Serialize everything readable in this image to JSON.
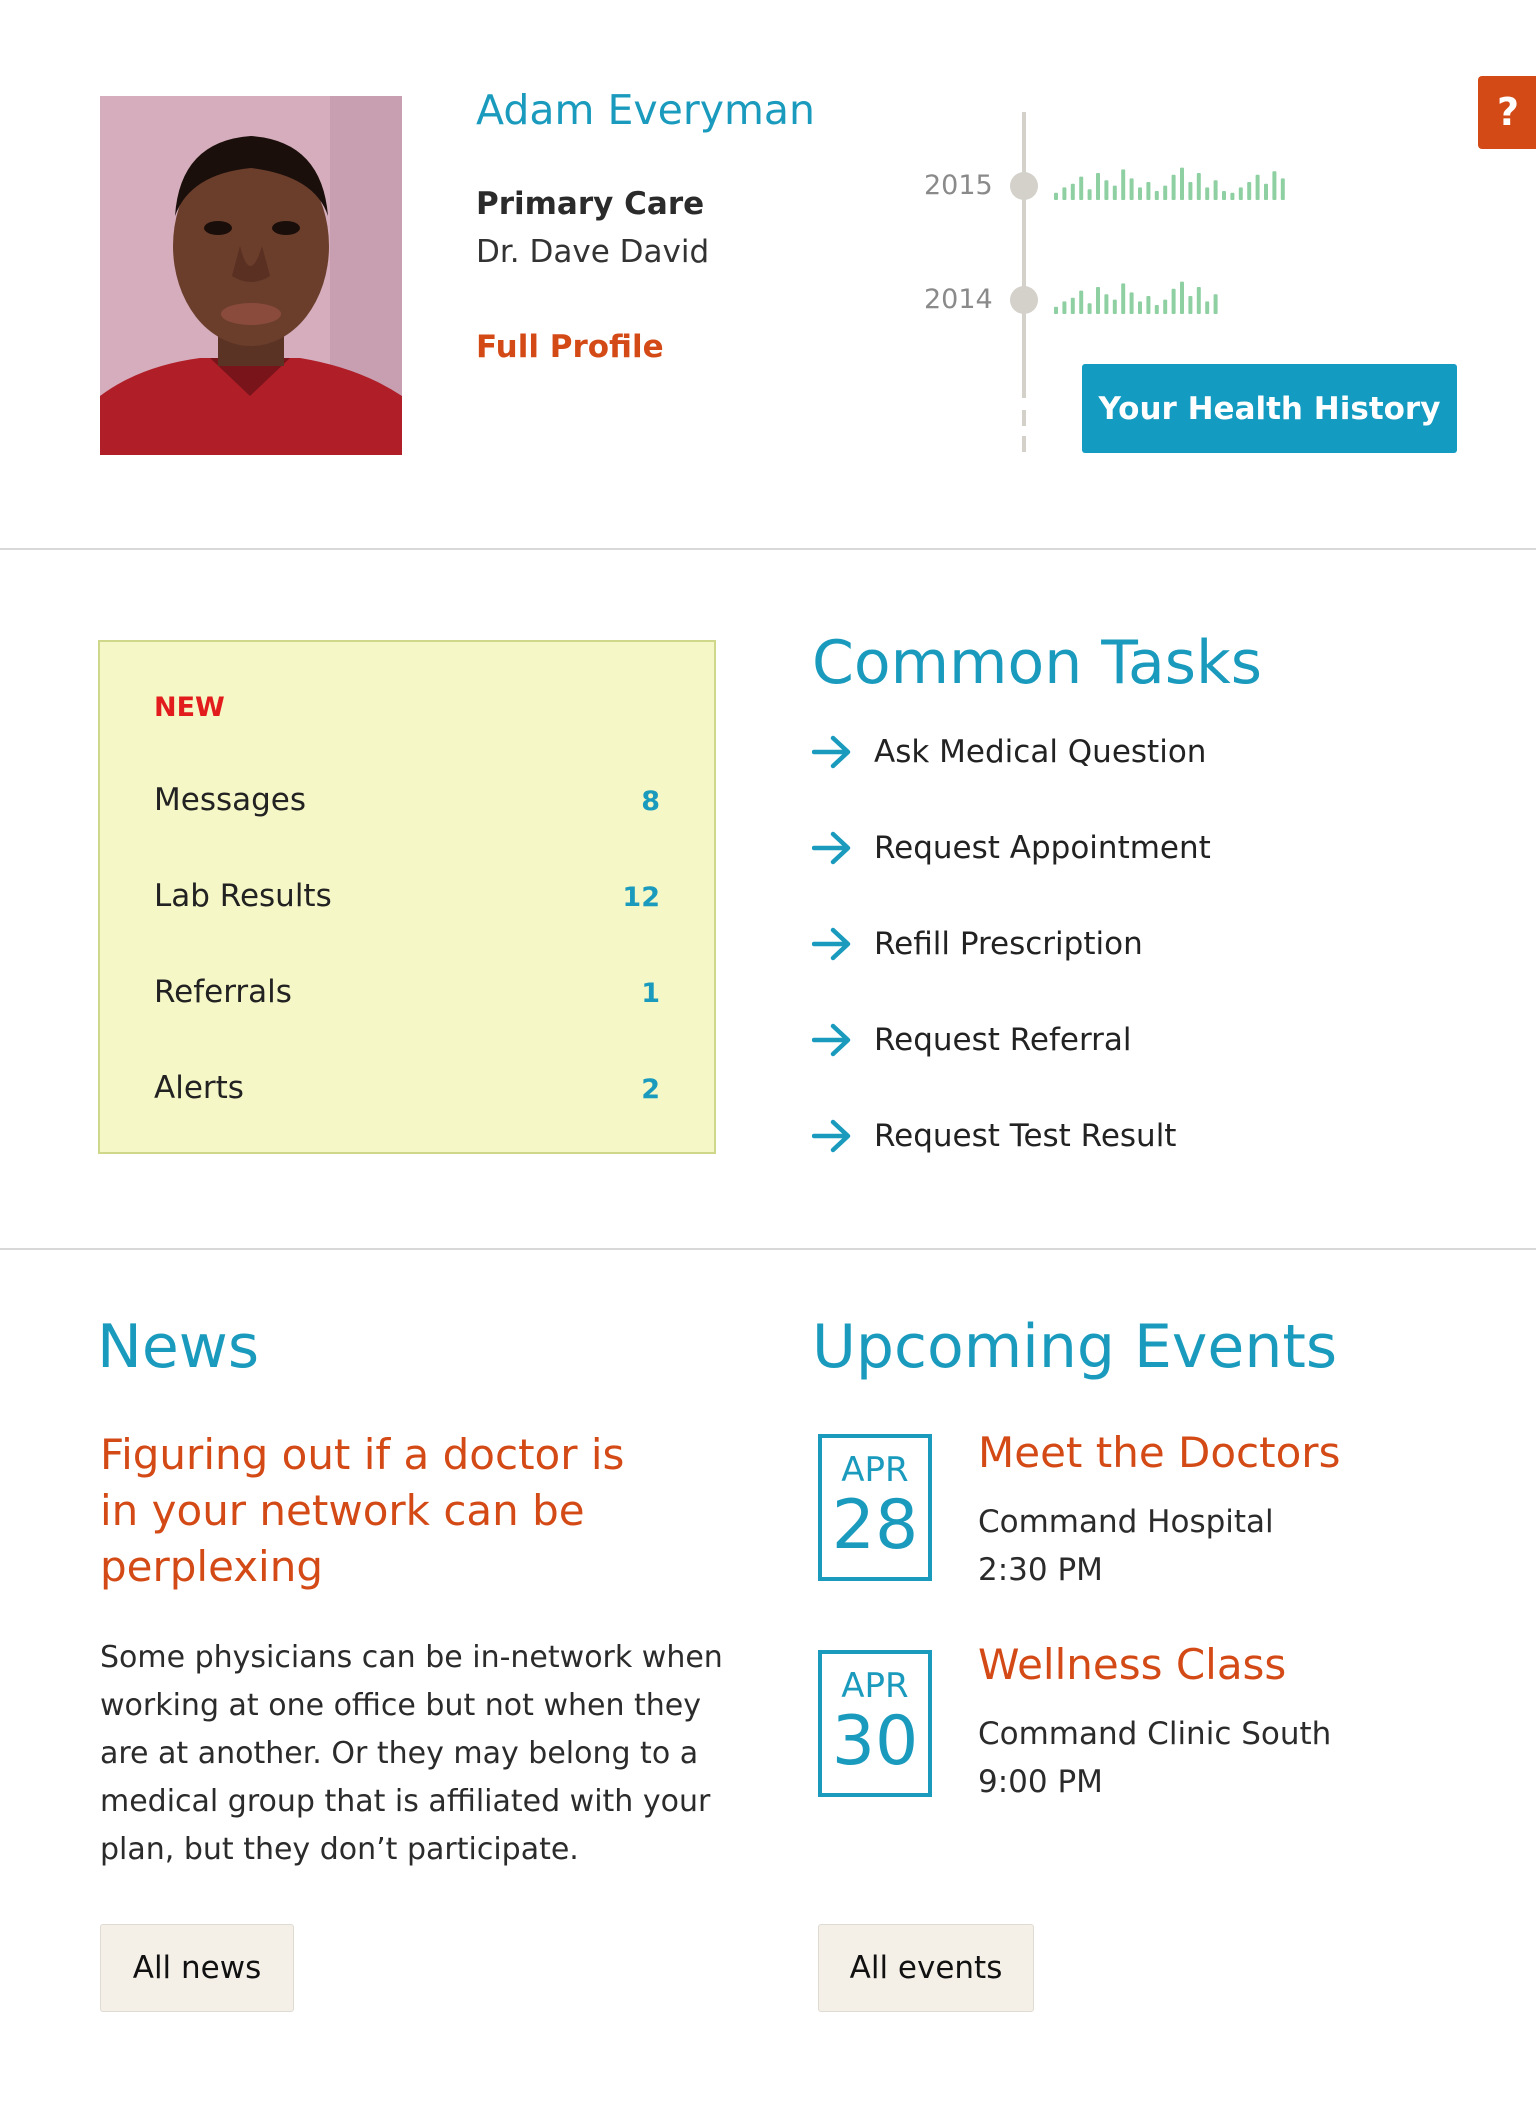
{
  "help": {
    "label": "?"
  },
  "profile": {
    "name": "Adam Everyman",
    "primary_care_label": "Primary Care",
    "doctor": "Dr. Dave David",
    "full_profile_link": "Full Profile"
  },
  "health_history": {
    "years": [
      "2015",
      "2014"
    ],
    "button_label": "Your Health History"
  },
  "new_items": {
    "header": "NEW",
    "rows": [
      {
        "label": "Messages",
        "count": "8"
      },
      {
        "label": "Lab Results",
        "count": "12"
      },
      {
        "label": "Referrals",
        "count": "1"
      },
      {
        "label": "Alerts",
        "count": "2"
      }
    ]
  },
  "common_tasks": {
    "title": "Common Tasks",
    "items": [
      "Ask Medical Question",
      "Request Appointment",
      "Refill Prescription",
      "Request Referral",
      "Request Test Result"
    ]
  },
  "news": {
    "title": "News",
    "headline": "Figuring out if a doctor is in your network can be perplexing",
    "body": "Some physicians can be in-network when working at one office but not when they are at another. Or they may belong to a medical group that is affiliated with your plan, but they don’t participate.",
    "all_button": "All news"
  },
  "events": {
    "title": "Upcoming Events",
    "items": [
      {
        "month": "APR",
        "day": "28",
        "title": "Meet the Doctors",
        "location": "Command Hospital",
        "time": "2:30 PM"
      },
      {
        "month": "APR",
        "day": "30",
        "title": "Wellness Class",
        "location": "Command Clinic South",
        "time": "9:00 PM"
      }
    ],
    "all_button": "All events"
  },
  "colors": {
    "accent_blue": "#1a9bbd",
    "accent_orange": "#d44a16",
    "new_red": "#e21c1c",
    "new_box_bg": "#f6f7c6",
    "sparkline_green": "#8fd0a3"
  }
}
